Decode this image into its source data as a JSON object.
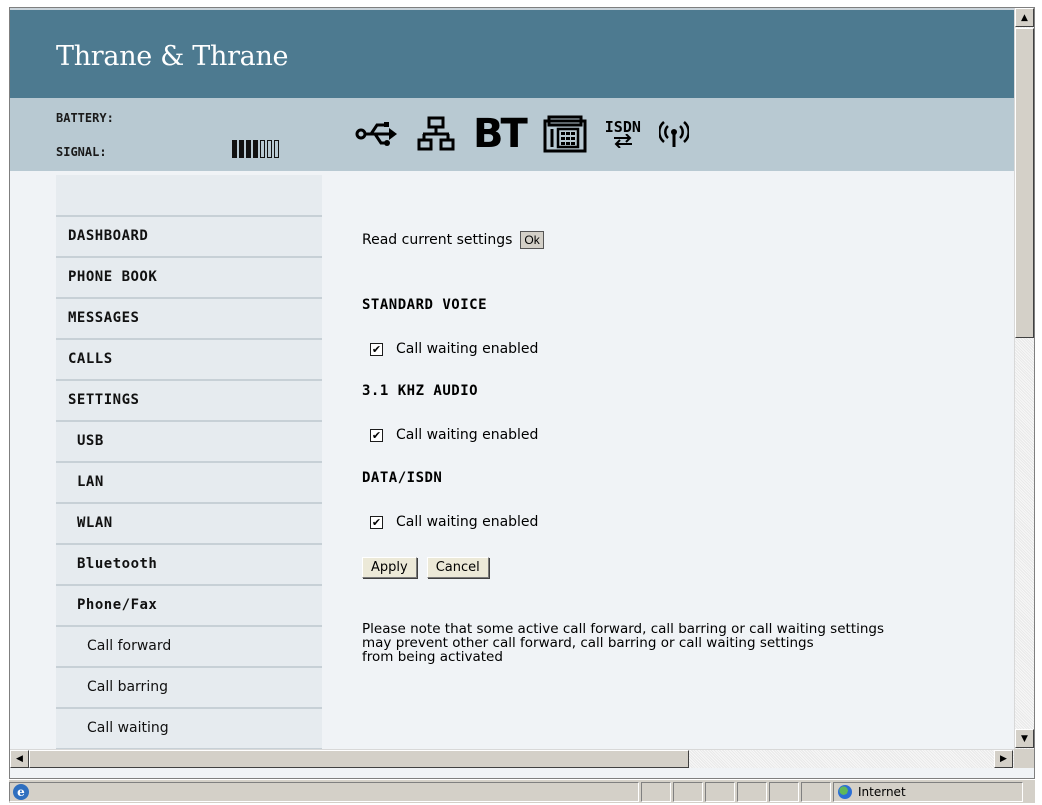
{
  "header": {
    "brand": "Thrane & Thrane"
  },
  "status": {
    "battery_label": "BATTERY:",
    "signal_label": "SIGNAL:",
    "signal_level": 4,
    "signal_max": 7,
    "interfaces": [
      "usb-icon",
      "lan-icon",
      "bluetooth-icon",
      "phone-icon",
      "isdn-icon",
      "wlan-icon"
    ],
    "bt_text": "BT",
    "isdn_text": "ISDN"
  },
  "sidebar": {
    "items": [
      {
        "label": "DASHBOARD",
        "level": 0
      },
      {
        "label": "PHONE BOOK",
        "level": 0
      },
      {
        "label": "MESSAGES",
        "level": 0
      },
      {
        "label": "CALLS",
        "level": 0
      },
      {
        "label": "SETTINGS",
        "level": 0
      },
      {
        "label": "USB",
        "level": 1
      },
      {
        "label": "LAN",
        "level": 1
      },
      {
        "label": "WLAN",
        "level": 1
      },
      {
        "label": "Bluetooth",
        "level": 1
      },
      {
        "label": "Phone/Fax",
        "level": 1
      },
      {
        "label": "Call forward",
        "level": 2
      },
      {
        "label": "Call barring",
        "level": 2
      },
      {
        "label": "Call waiting",
        "level": 2
      }
    ]
  },
  "main": {
    "read_label": "Read current settings",
    "ok_label": "Ok",
    "sections": [
      {
        "title": "STANDARD VOICE",
        "checkbox_label": "Call waiting enabled",
        "checked": true
      },
      {
        "title": "3.1 KHZ AUDIO",
        "checkbox_label": "Call waiting enabled",
        "checked": true
      },
      {
        "title": "DATA/ISDN",
        "checkbox_label": "Call waiting enabled",
        "checked": true
      }
    ],
    "apply_label": "Apply",
    "cancel_label": "Cancel",
    "note_lines": [
      "Please note that some active call forward, call barring or call waiting settings",
      "may prevent other call forward, call barring or call waiting settings",
      "from being activated"
    ]
  },
  "browser": {
    "zone_label": "Internet"
  }
}
